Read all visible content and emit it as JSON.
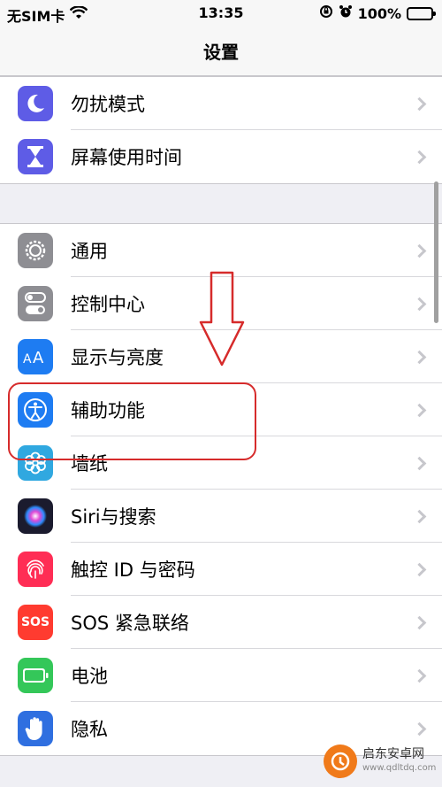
{
  "status_bar": {
    "carrier": "无SIM卡",
    "time": "13:35",
    "battery": "100%",
    "battery_level": 1.0
  },
  "nav": {
    "title": "设置"
  },
  "groups": [
    {
      "items": [
        {
          "label": "勿扰模式",
          "icon": "moon-icon",
          "color": "#5e5ce6"
        },
        {
          "label": "屏幕使用时间",
          "icon": "hourglass-icon",
          "color": "#5e5ce6"
        }
      ]
    },
    {
      "items": [
        {
          "label": "通用",
          "icon": "gear-icon",
          "color": "#8e8e93"
        },
        {
          "label": "控制中心",
          "icon": "switches-icon",
          "color": "#8e8e93"
        },
        {
          "label": "显示与亮度",
          "icon": "text-size-icon",
          "color": "#1e7cf2"
        },
        {
          "label": "辅助功能",
          "icon": "accessibility-icon",
          "color": "#1e7cf2"
        },
        {
          "label": "墙纸",
          "icon": "flower-icon",
          "color": "#30a8e0"
        },
        {
          "label": "Siri与搜索",
          "icon": "siri-icon",
          "color": "#1b1b2e"
        },
        {
          "label": "触控 ID 与密码",
          "icon": "fingerprint-icon",
          "color": "#ff2d55"
        },
        {
          "label": "SOS 紧急联络",
          "icon": "sos-icon",
          "color": "#ff3b30"
        },
        {
          "label": "电池",
          "icon": "battery-icon",
          "color": "#34c759"
        },
        {
          "label": "隐私",
          "icon": "hand-icon",
          "color": "#2f6fe0"
        }
      ]
    }
  ],
  "sos_text": "SOS",
  "annotation_color": "#d62b2b",
  "watermark": {
    "name": "启东安卓网",
    "url": "www.qdltdq.com"
  }
}
